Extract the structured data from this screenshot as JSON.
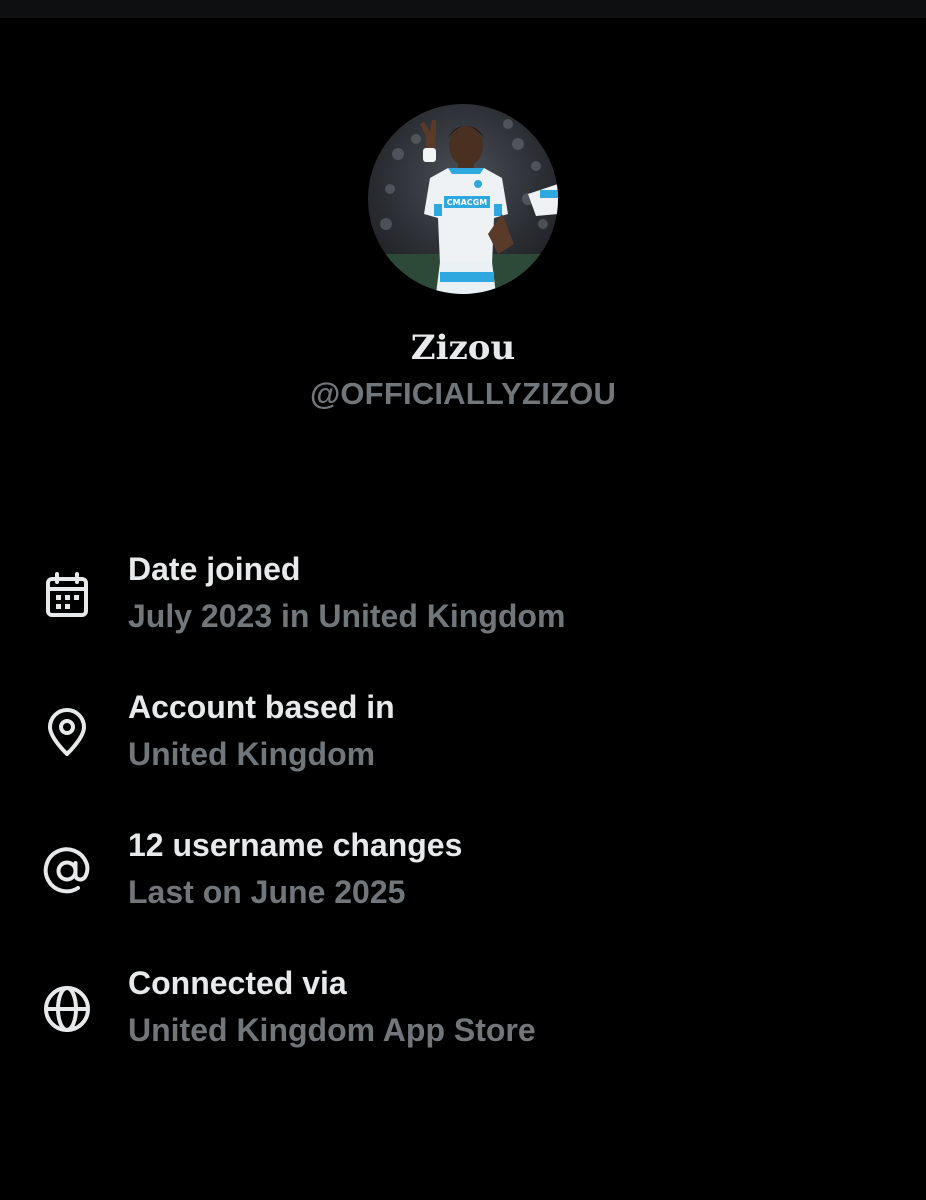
{
  "profile": {
    "display_name": "Zizou",
    "handle": "@OFFICIALLYZIZOU",
    "avatar_jersey_text": "CMACGM"
  },
  "about": [
    {
      "icon": "calendar-icon",
      "title": "Date joined",
      "subtitle": "July 2023 in United Kingdom"
    },
    {
      "icon": "location-pin-icon",
      "title": "Account based in",
      "subtitle": "United Kingdom"
    },
    {
      "icon": "at-sign-icon",
      "title": "12 username changes",
      "subtitle": "Last on June 2025"
    },
    {
      "icon": "globe-icon",
      "title": "Connected via",
      "subtitle": "United Kingdom App Store"
    }
  ],
  "colors": {
    "background": "#000000",
    "primary_text": "#e7e9ea",
    "secondary_text": "#71767b",
    "accent_sky_blue": "#2fa8e0"
  }
}
